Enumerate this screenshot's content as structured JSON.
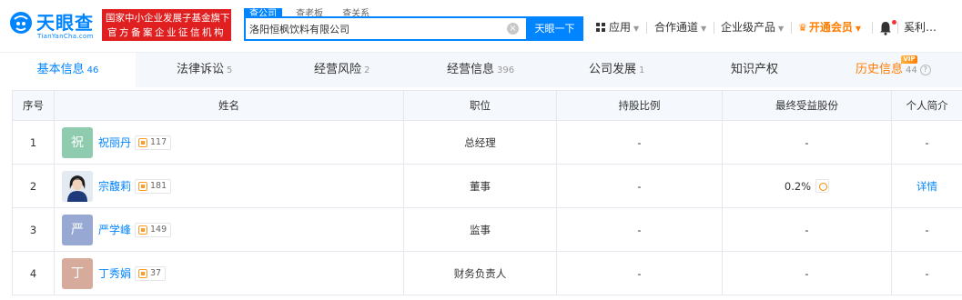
{
  "logo": {
    "text": "天眼查",
    "sub": "TianYanCha.com"
  },
  "banner": {
    "line1": "国家中小企业发展子基金旗下",
    "line2": "官方备案企业征信机构"
  },
  "search": {
    "tabs": [
      "查公司",
      "查老板",
      "查关系"
    ],
    "value": "洛阳恒枫饮料有限公司",
    "button": "天眼一下"
  },
  "nav": {
    "apps": "应用",
    "coop": "合作通道",
    "enterprise": "企业级产品",
    "vip": "开通会员",
    "user": "奚利…"
  },
  "tabs": [
    {
      "label": "基本信息",
      "count": "46"
    },
    {
      "label": "法律诉讼",
      "count": "5"
    },
    {
      "label": "经营风险",
      "count": "2"
    },
    {
      "label": "经营信息",
      "count": "396"
    },
    {
      "label": "公司发展",
      "count": "1"
    },
    {
      "label": "知识产权",
      "count": ""
    },
    {
      "label": "历史信息",
      "count": "44",
      "badge": "VIP"
    }
  ],
  "table": {
    "headers": [
      "序号",
      "姓名",
      "职位",
      "持股比例",
      "最终受益股份",
      "个人简介"
    ],
    "rows": [
      {
        "no": "1",
        "avatar": "祝",
        "avatar_color": "#8fcbae",
        "name": "祝丽丹",
        "companies": "117",
        "position": "总经理",
        "share": "-",
        "benefit": "-",
        "profile": "-"
      },
      {
        "no": "2",
        "avatar": "",
        "avatar_color": "photo",
        "name": "宗馥莉",
        "companies": "181",
        "position": "董事",
        "share": "-",
        "benefit": "0.2%",
        "profile": "详情"
      },
      {
        "no": "3",
        "avatar": "严",
        "avatar_color": "#97a9d3",
        "name": "严学峰",
        "companies": "149",
        "position": "监事",
        "share": "-",
        "benefit": "-",
        "profile": "-"
      },
      {
        "no": "4",
        "avatar": "丁",
        "avatar_color": "#d6ab9b",
        "name": "丁秀娟",
        "companies": "37",
        "position": "财务负责人",
        "share": "-",
        "benefit": "-",
        "profile": "-"
      }
    ]
  }
}
